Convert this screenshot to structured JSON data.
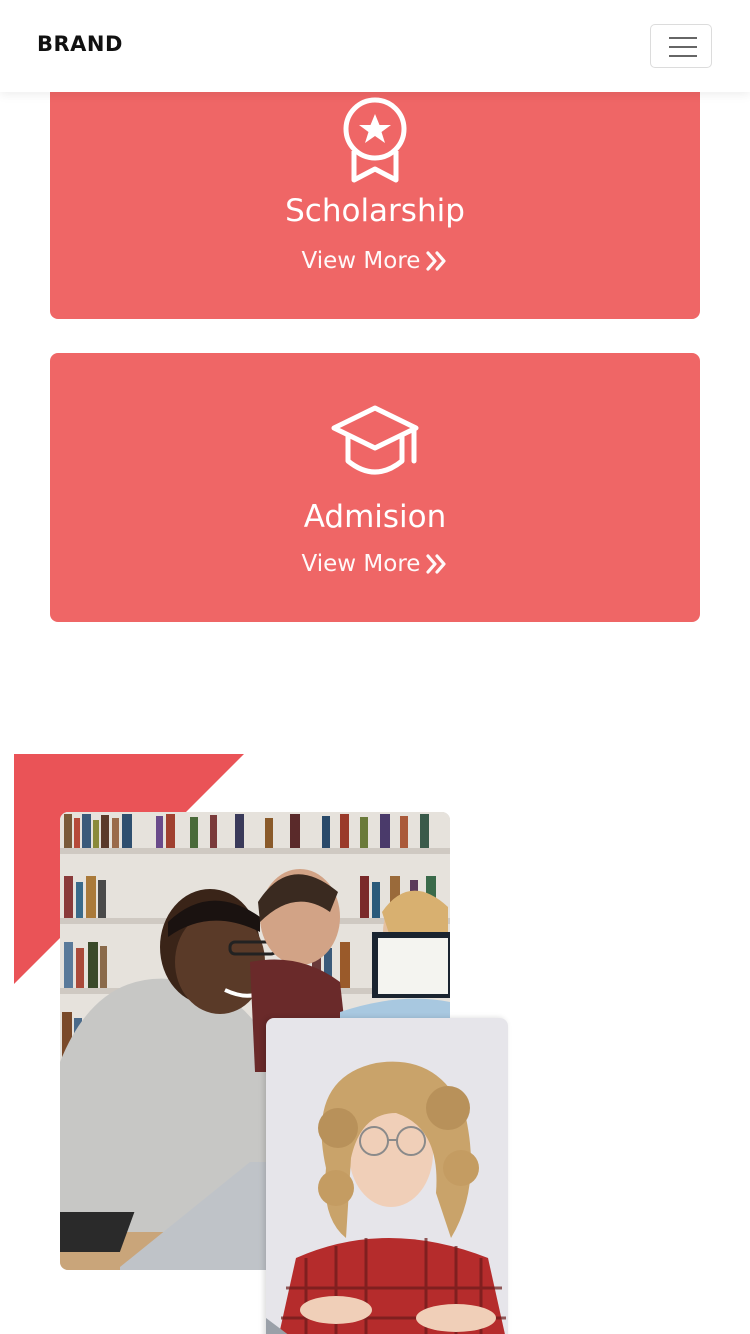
{
  "navbar": {
    "brand": "BRAND",
    "toggler_icon": "hamburger-menu-icon"
  },
  "cards": [
    {
      "icon": "award-ribbon-icon",
      "title": "Scholarship",
      "link_label": "View More",
      "link_icon": "double-chevron-right-icon"
    },
    {
      "icon": "graduation-cap-icon",
      "title": "Admision",
      "link_label": "View More",
      "link_icon": "double-chevron-right-icon"
    }
  ],
  "colors": {
    "card_bg": "#ef6666",
    "accent_triangle": "#ea5357",
    "text_on_card": "#ffffff"
  },
  "images": [
    {
      "name": "students-library-photo"
    },
    {
      "name": "student-laptop-photo"
    }
  ]
}
